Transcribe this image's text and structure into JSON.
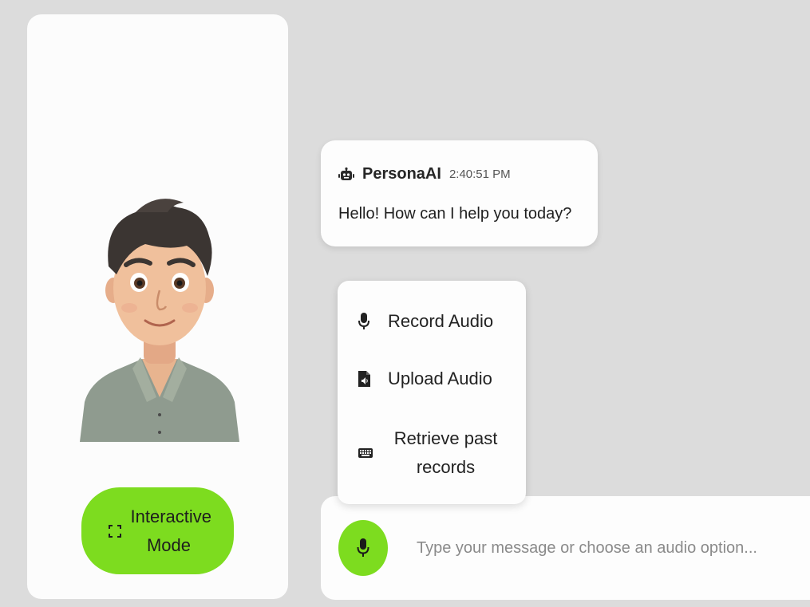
{
  "left_panel": {
    "avatar_icon": "avatar-illustration",
    "interactive_mode": {
      "label": "Interactive Mode",
      "icon": "expand-icon",
      "color": "#7ddc1f"
    }
  },
  "chat": {
    "messages": [
      {
        "sender": "PersonaAI",
        "sender_icon": "robot-icon",
        "timestamp": "2:40:51 PM",
        "text": "Hello! How can I help you today?"
      }
    ]
  },
  "audio_menu": {
    "items": [
      {
        "label": "Record Audio",
        "icon": "microphone-icon"
      },
      {
        "label": "Upload Audio",
        "icon": "audio-file-icon"
      },
      {
        "label": "Retrieve past records",
        "icon": "keyboard-icon"
      }
    ]
  },
  "input_bar": {
    "placeholder": "Type your message or choose an audio option...",
    "value": "",
    "mic_icon": "microphone-icon",
    "accent_color": "#7ddc1f"
  },
  "colors": {
    "background": "#dcdcdc",
    "panel": "#fcfcfc",
    "accent": "#7ddc1f"
  }
}
